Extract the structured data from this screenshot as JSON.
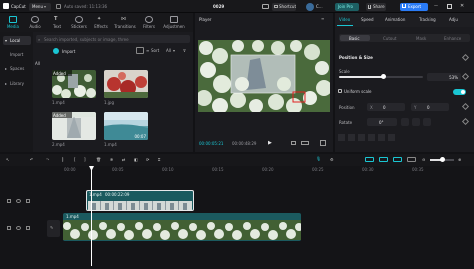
{
  "titlebar": {
    "app_name": "CapCut",
    "menu_label": "Menu",
    "autosave_text": "Auto saved: 11:13:36",
    "project_name": "0029",
    "shortcut_label": "Shortcut",
    "user_label": "C...",
    "join_pro_label": "Join Pro",
    "share_label": "Share",
    "export_label": "Export"
  },
  "tooltabs": [
    {
      "label": "Media",
      "active": true
    },
    {
      "label": "Audio"
    },
    {
      "label": "Text"
    },
    {
      "label": "Stickers"
    },
    {
      "label": "Effects"
    },
    {
      "label": "Transitions"
    },
    {
      "label": "Filters"
    },
    {
      "label": "Adjustmen"
    }
  ],
  "media": {
    "sidebar": [
      {
        "label": "Local",
        "active": true
      },
      {
        "label": "Import"
      },
      {
        "label": "Spaces"
      },
      {
        "label": "Library"
      }
    ],
    "search_placeholder": "Search imported, subjects or image, three",
    "import_label": "Import",
    "sort_label": "Sort",
    "filter_label": "All",
    "all_label": "All",
    "items": [
      {
        "name": "1.mp4",
        "badge": "Added",
        "duration": ""
      },
      {
        "name": "1.jpg",
        "badge": "",
        "duration": ""
      },
      {
        "name": "2.mp4",
        "badge": "Added",
        "duration": ""
      },
      {
        "name": "1.mp4",
        "badge": "",
        "duration": "00:07"
      }
    ]
  },
  "player": {
    "title": "Player",
    "current_time": "00:00:05:21",
    "total_time": "00:00:48:29"
  },
  "inspector": {
    "tabs": [
      "Video",
      "Speed",
      "Animation",
      "Tracking",
      "Adju"
    ],
    "subtabs": [
      "Basic",
      "Cutout",
      "Mask",
      "Enhance"
    ],
    "section_title": "Position & Size",
    "scale_label": "Scale",
    "scale_value": "53%",
    "scale_fraction": 0.53,
    "uniform_scale_label": "Uniform scale",
    "position_label": "Position",
    "pos_x_label": "X",
    "pos_x_value": "0",
    "pos_y_label": "Y",
    "pos_y_value": "0",
    "rotate_label": "Rotate",
    "rotate_value": "0°"
  },
  "timeline": {
    "ruler": [
      "00:00",
      "00:05",
      "00:10",
      "00:15",
      "00:20",
      "00:25",
      "00:30",
      "00:35"
    ],
    "overlay_clip": {
      "name": "1.mp4",
      "duration": "00:00:22:09"
    },
    "main_clip": {
      "name": "1.mp4",
      "duration": "00:00:48:29"
    },
    "cover_label": "Cover"
  },
  "colors": {
    "accent": "#1ac6d3",
    "export": "#2a7bf6",
    "join_pro": "#1fd1c6",
    "playhead": "#ffffff"
  }
}
